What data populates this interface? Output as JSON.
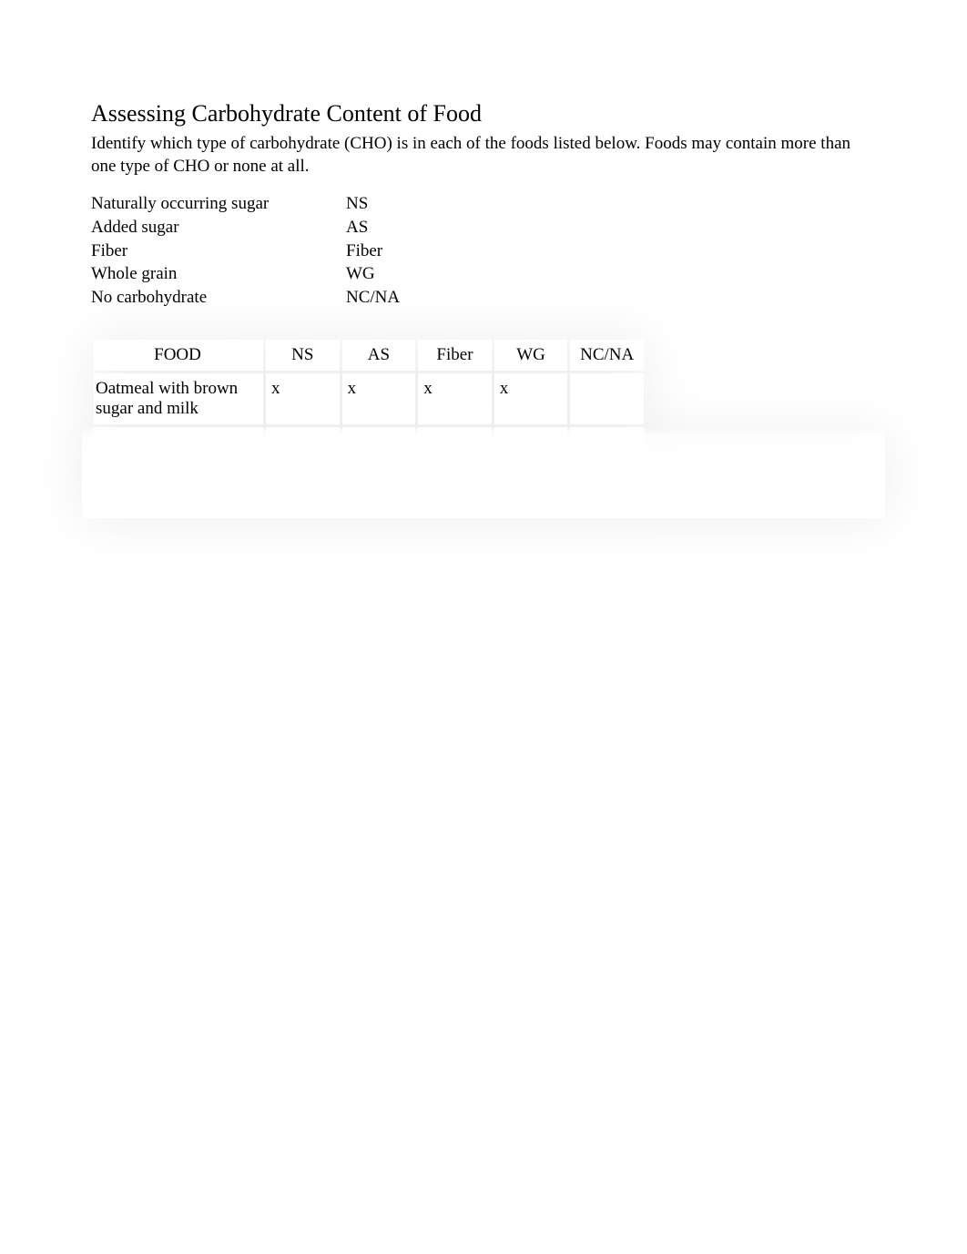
{
  "title": "Assessing Carbohydrate Content of Food",
  "instructions": "Identify which type of carbohydrate (CHO) is in each of the foods listed below. Foods may contain more than one type of CHO or none at all.",
  "legend": [
    {
      "label": "Naturally occurring sugar",
      "abbr": "NS"
    },
    {
      "label": "Added sugar",
      "abbr": "AS"
    },
    {
      "label": "Fiber",
      "abbr": "Fiber"
    },
    {
      "label": "Whole grain",
      "abbr": "WG"
    },
    {
      "label": "No carbohydrate",
      "abbr": "NC/NA"
    }
  ],
  "table": {
    "headers": {
      "food": "FOOD",
      "ns": "NS",
      "as": "AS",
      "fiber": "Fiber",
      "wg": "WG",
      "ncna": "NC/NA"
    },
    "rows": [
      {
        "food": "Oatmeal with brown sugar and milk",
        "ns": "x",
        "as": "x",
        "fiber": "x",
        "wg": "x",
        "ncna": ""
      },
      {
        "food": "",
        "ns": "",
        "as": "",
        "fiber": "",
        "wg": "",
        "ncna": ""
      },
      {
        "food": "",
        "ns": "",
        "as": "",
        "fiber": "",
        "wg": "",
        "ncna": ""
      },
      {
        "food": "",
        "ns": "",
        "as": "",
        "fiber": "",
        "wg": "",
        "ncna": ""
      },
      {
        "food": "",
        "ns": "",
        "as": "",
        "fiber": "",
        "wg": "",
        "ncna": ""
      },
      {
        "food": "",
        "ns": "",
        "as": "",
        "fiber": "",
        "wg": "",
        "ncna": ""
      },
      {
        "food": "",
        "ns": "",
        "as": "",
        "fiber": "",
        "wg": "",
        "ncna": ""
      }
    ]
  }
}
